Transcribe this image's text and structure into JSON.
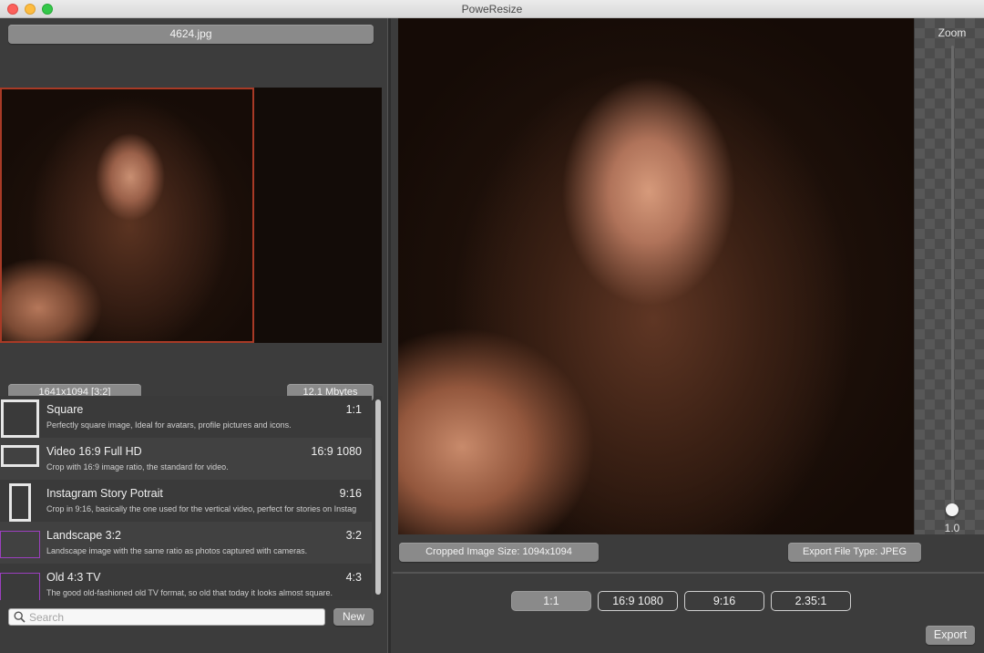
{
  "window": {
    "title": "PoweResize"
  },
  "left": {
    "filename": "4624.jpg",
    "dimensions": "1641x1094 [3:2]",
    "file_size": "12.1 Mbytes",
    "presets": [
      {
        "name": "Square",
        "ratio": "1:1",
        "description": "Perfectly square image, Ideal for avatars, profile pictures and icons."
      },
      {
        "name": "Video 16:9 Full HD",
        "ratio": "16:9 1080",
        "description": "Crop with 16:9 image ratio, the standard for video."
      },
      {
        "name": "Instagram Story Potrait",
        "ratio": "9:16",
        "description": "Crop in 9:16, basically the one used for the vertical video, perfect for stories on Instag"
      },
      {
        "name": "Landscape 3:2",
        "ratio": "3:2",
        "description": "Landscape image with the same ratio as photos captured with cameras."
      },
      {
        "name": "Old 4:3 TV",
        "ratio": "4:3",
        "description": "The good old-fashioned old TV format, so old that today it looks almost square."
      }
    ],
    "search": {
      "placeholder": "Search",
      "value": ""
    },
    "new_label": "New"
  },
  "right": {
    "zoom_label": "Zoom",
    "zoom_value": "1.0",
    "zoom_level": 1.0,
    "cropped_size": "Cropped Image Size: 1094x1094",
    "export_file_type": "Export File Type: JPEG",
    "ratio_buttons": [
      "1:1",
      "16:9 1080",
      "9:16",
      "2.35:1"
    ],
    "active_ratio": "1:1",
    "export_label": "Export"
  },
  "colors": {
    "crop_frame": "#a83a26",
    "preset_icon_purple": "#9b3fbf"
  },
  "icons": {
    "search": "magnifier-icon"
  }
}
